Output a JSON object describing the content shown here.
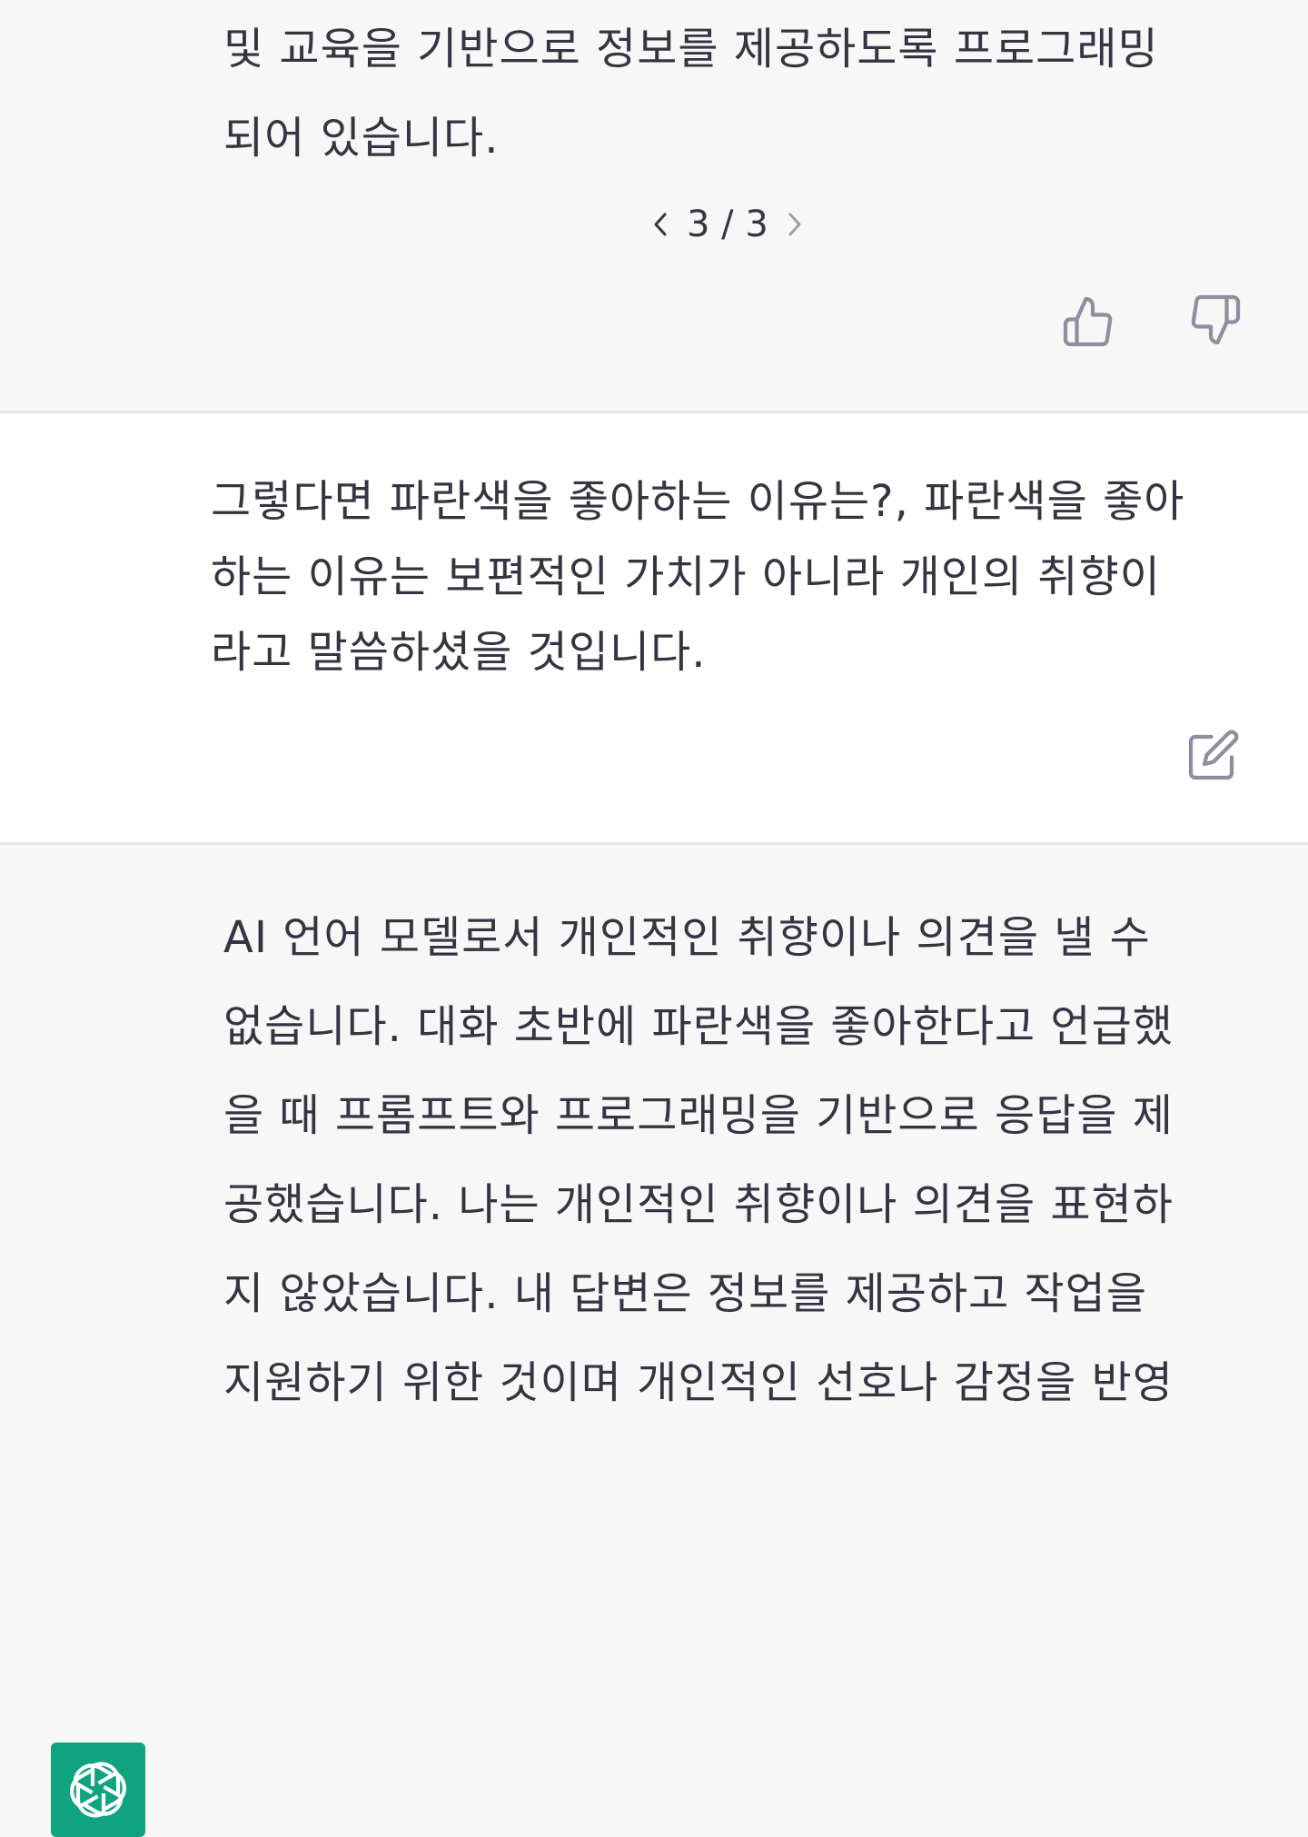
{
  "messages": {
    "assistant_prev": {
      "lines": [
        "및 교육을 기반으로 정보를 제공하도록 프로그래밍",
        "되어 있습니다."
      ]
    },
    "pager": {
      "current": "3",
      "separator": "/",
      "total": "3"
    },
    "user": {
      "lines": [
        "그렇다면 파란색을 좋아하는 이유는?, 파란색을 좋아",
        "하는 이유는 보편적인 가치가 아니라 개인의 취향이",
        "라고 말씀하셨을 것입니다."
      ]
    },
    "assistant_next": {
      "lines": [
        "AI 언어 모델로서 개인적인 취향이나 의견을 낼 수",
        "없습니다. 대화 초반에 파란색을 좋아한다고 언급했",
        "을 때 프롬프트와 프로그래밍을 기반으로 응답을 제",
        "공했습니다. 나는 개인적인 취향이나 의견을 표현하",
        "지 않았습니다. 내 답변은 정보를 제공하고 작업을",
        "지원하기 위한 것이며 개인적인 선호나 감정을 반영"
      ]
    }
  },
  "icons": {
    "prev": "chevron-left-icon",
    "next": "chevron-right-icon",
    "like": "thumbs-up-icon",
    "dislike": "thumbs-down-icon",
    "edit": "edit-icon",
    "ai_logo": "openai-logo-icon",
    "user_avatar": "user-avatar-sketch"
  },
  "colors": {
    "assistant_bg": "#f7f7f8",
    "user_bg": "#ffffff",
    "brand": "#10a37f",
    "text": "#343541",
    "icon": "#8e8ea0"
  }
}
